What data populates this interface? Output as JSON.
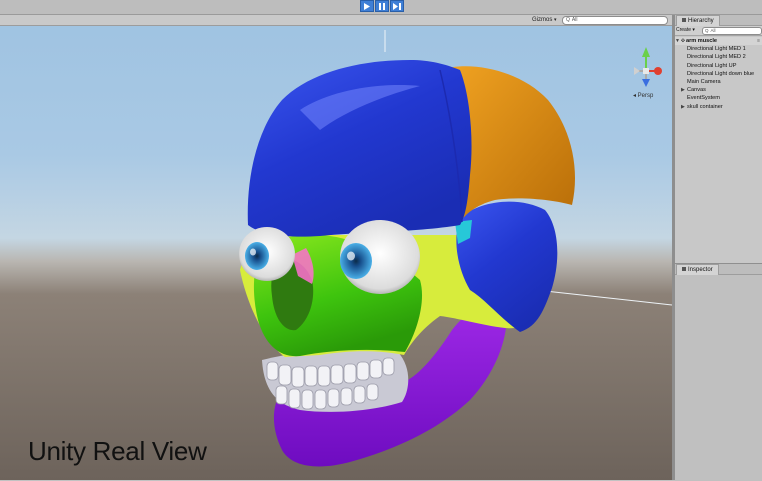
{
  "toolbar": {
    "play_buttons": [
      "play-icon",
      "pause-icon",
      "step-icon"
    ]
  },
  "scene": {
    "gizmos_label": "Gizmos",
    "gizmos_caret": "▾",
    "search_icon": "Q",
    "search_placeholder": "All",
    "persp_label": "◂ Persp",
    "caption": "Unity Real View"
  },
  "hierarchy": {
    "tab_label": "Hierarchy",
    "create_label": "Create ▾",
    "search_icon": "Q",
    "search_placeholder": "All",
    "root": "arm muscle",
    "items": [
      {
        "label": "Directional Light MED 1",
        "expandable": false
      },
      {
        "label": "Directional Light MED 2",
        "expandable": false
      },
      {
        "label": "Directional Light UP",
        "expandable": false
      },
      {
        "label": "Directional Light down blue",
        "expandable": false
      },
      {
        "label": "Main Camera",
        "expandable": false
      },
      {
        "label": "Canvas",
        "expandable": true
      },
      {
        "label": "EventSystem",
        "expandable": false
      },
      {
        "label": "skull container",
        "expandable": true
      }
    ]
  },
  "inspector": {
    "tab_label": "Inspector"
  },
  "colors": {
    "play_blue": "#3f7fd6",
    "skull_blue": "#2f46d6",
    "skull_orange": "#d98a12",
    "skull_green": "#55cc11",
    "skull_yellow": "#d8e83a",
    "skull_purple": "#8a16d8",
    "eye_iris": "#2c8fcf"
  }
}
